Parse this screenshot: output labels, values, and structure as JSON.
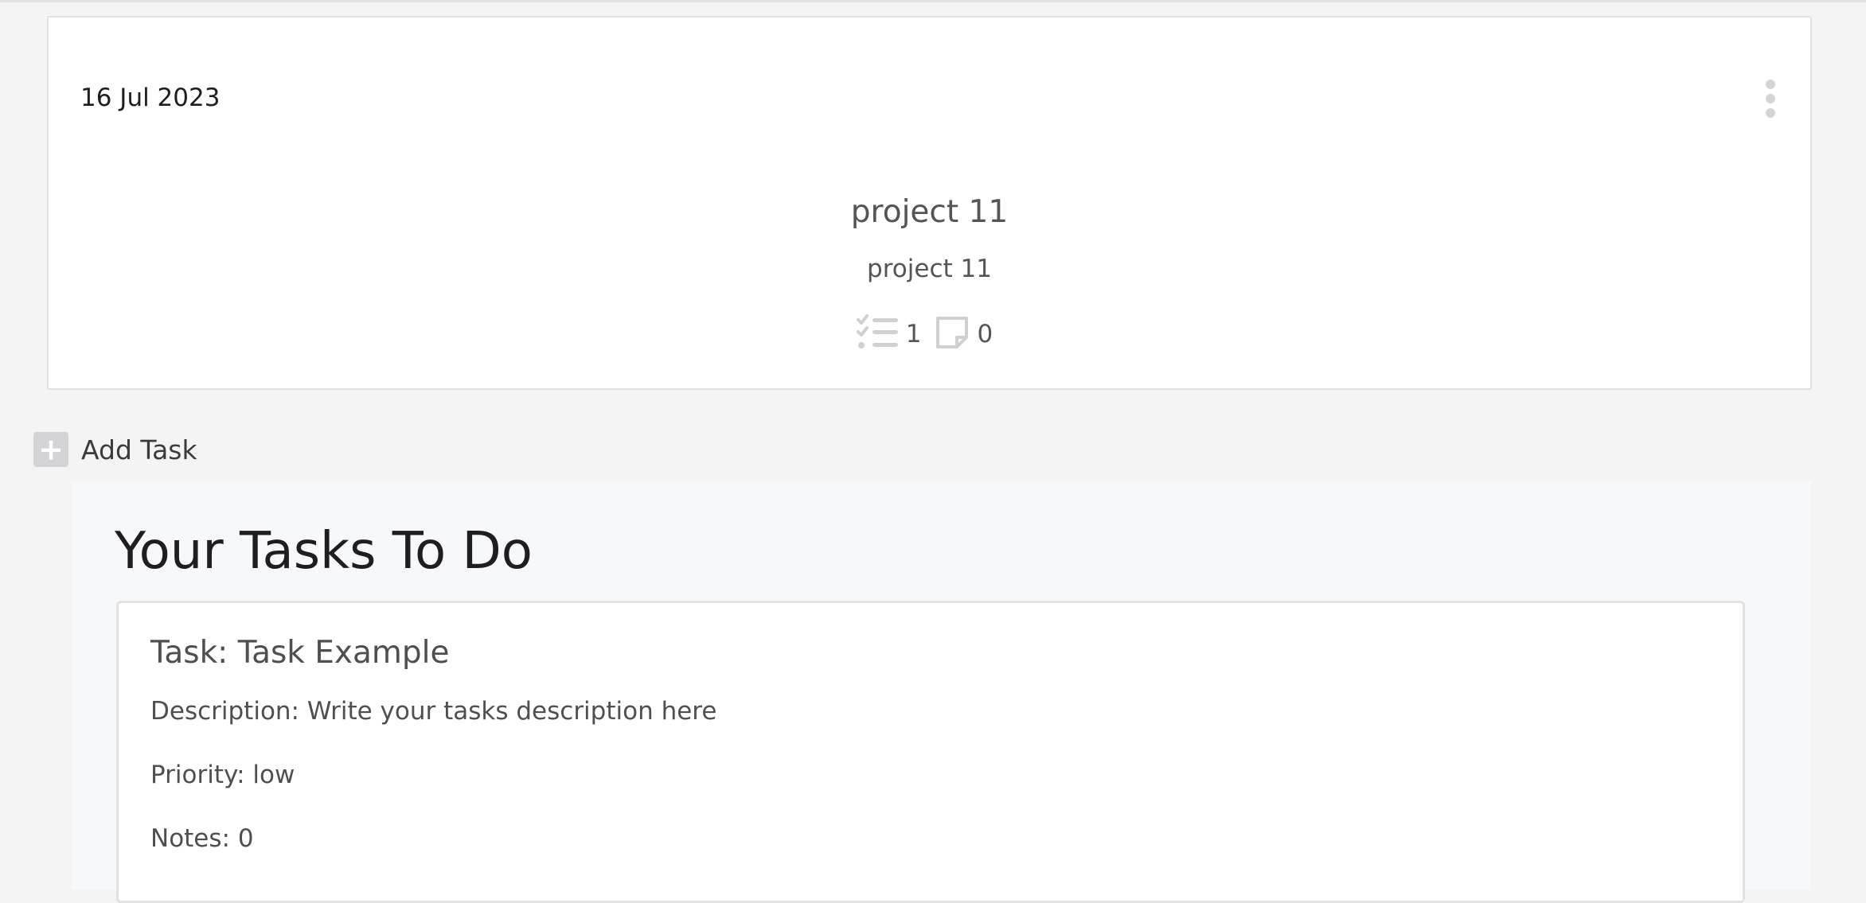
{
  "project_card": {
    "date": "16 Jul 2023",
    "title": "project 11",
    "subtitle": "project 11",
    "task_count": "1",
    "note_count": "0",
    "task_icon": "checklist-icon",
    "note_icon": "sticky-note-icon",
    "menu_icon": "kebab-menu-icon"
  },
  "add_task": {
    "label": "Add Task",
    "icon": "plus-icon"
  },
  "tasks_section": {
    "heading": "Your Tasks To Do",
    "tasks": [
      {
        "title": "Task: Task Example",
        "description": "Description: Write your tasks description here",
        "priority": "Priority: low",
        "notes": "Notes: 0"
      }
    ]
  },
  "colors": {
    "background": "#f4f4f5",
    "card": "#ffffff",
    "border": "#e2e2e2",
    "icon_gray": "#d4d4d4"
  }
}
